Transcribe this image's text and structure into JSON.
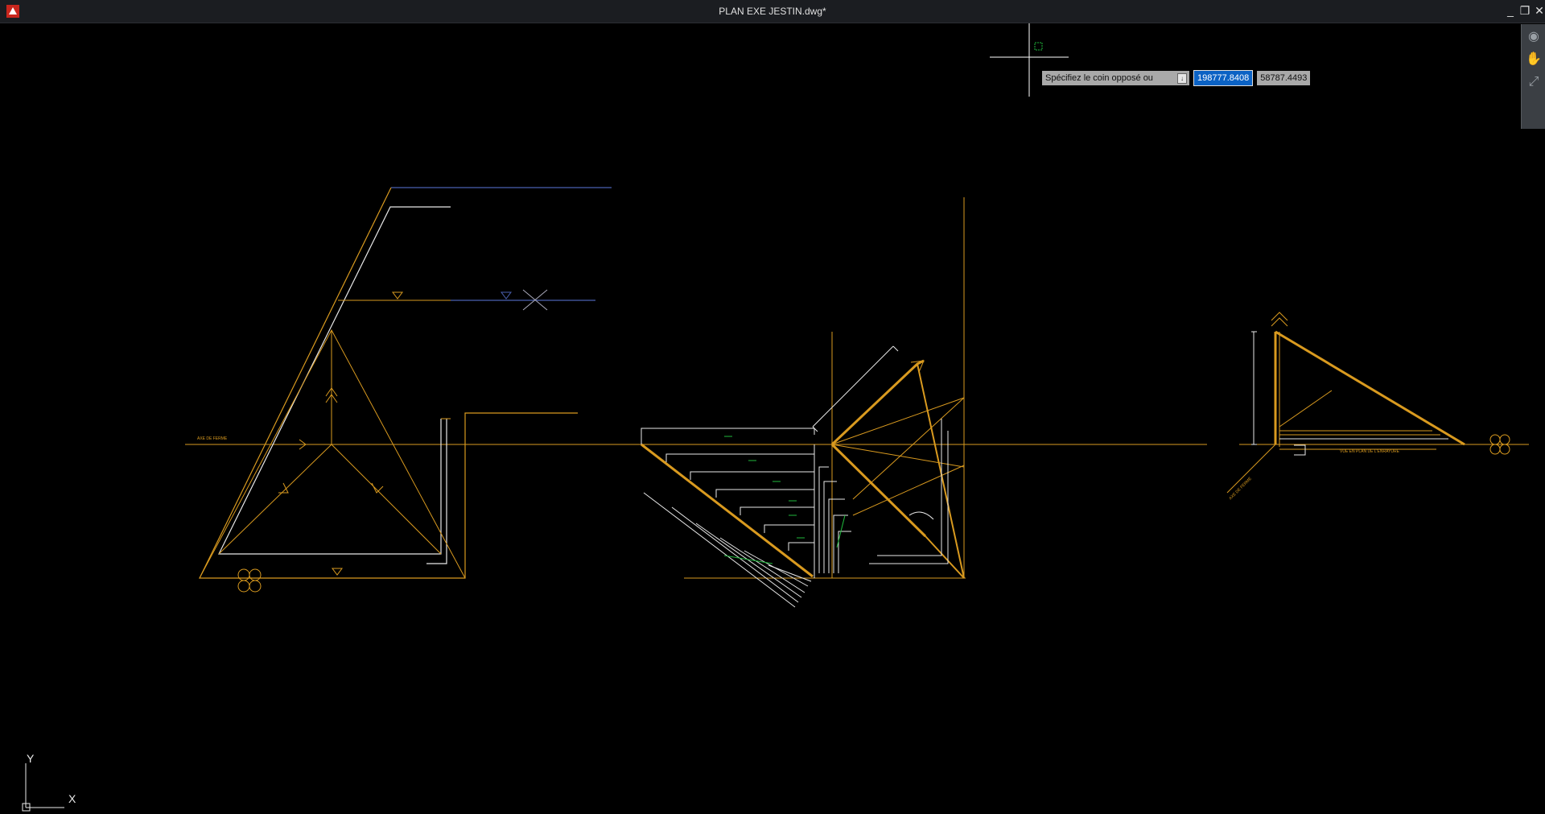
{
  "window": {
    "title": "PLAN EXE JESTIN.dwg*",
    "minimize_glyph": "_",
    "restore_glyph": "❐",
    "close_glyph": "✕"
  },
  "command_prompt": {
    "label": "Spécifiez le coin opposé ou",
    "x_value": "198777.8408",
    "y_value": "58787.4493",
    "dropdown_glyph": "↓"
  },
  "navbar": {
    "icons": [
      "steering-wheel-icon",
      "pan-icon",
      "zoom-icon"
    ],
    "glyphs": [
      "◉",
      "✋",
      "⤢"
    ]
  },
  "drawing_labels": {
    "axe_ferme": "AXE DE FERME",
    "vue_plan": "VUE EN PLAN DE L'ENRAYURE",
    "axe_ferme_right": "AXE DE FERME"
  },
  "ucs": {
    "x_label": "X",
    "y_label": "Y"
  },
  "colors": {
    "background": "#000000",
    "orange": "#d99a1f",
    "white": "#e8e8e8",
    "blue": "#4a5fb0",
    "green": "#1fb83c",
    "selection": "#0b62c4"
  }
}
